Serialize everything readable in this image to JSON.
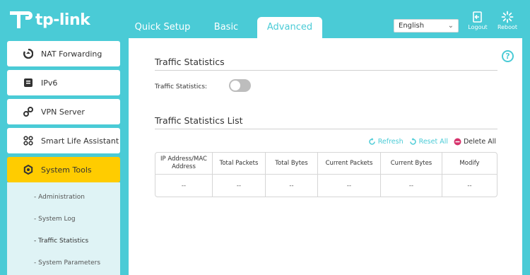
{
  "brand": {
    "name": "tp-link"
  },
  "nav": {
    "tabs": [
      {
        "label": "Quick Setup"
      },
      {
        "label": "Basic"
      },
      {
        "label": "Advanced"
      }
    ]
  },
  "header": {
    "language": {
      "selected": "English"
    },
    "logout_label": "Logout",
    "reboot_label": "Reboot"
  },
  "sidebar": {
    "items": [
      {
        "label": "NAT Forwarding",
        "icon": "nat-icon"
      },
      {
        "label": "IPv6",
        "icon": "ipv6-icon"
      },
      {
        "label": "VPN Server",
        "icon": "vpn-icon"
      },
      {
        "label": "Smart Life Assistant",
        "icon": "smart-life-icon"
      },
      {
        "label": "System Tools",
        "icon": "gear-icon"
      }
    ],
    "submenu": [
      {
        "label": "- Administration"
      },
      {
        "label": "- System Log"
      },
      {
        "label": "- Traffic Statistics"
      },
      {
        "label": "- System Parameters"
      }
    ]
  },
  "main": {
    "section1_title": "Traffic Statistics",
    "toggle_label": "Traffic Statistics:",
    "toggle_on": false,
    "section2_title": "Traffic Statistics List",
    "actions": {
      "refresh": "Refresh",
      "reset_all": "Reset All",
      "delete_all": "Delete All"
    },
    "table": {
      "headers": [
        "IP Address/MAC Address",
        "Total Packets",
        "Total Bytes",
        "Current Packets",
        "Current Bytes",
        "Modify"
      ],
      "rows": [
        [
          "--",
          "--",
          "--",
          "--",
          "--",
          "--"
        ]
      ]
    }
  },
  "colors": {
    "accent": "#4acbd6",
    "active": "#ffcc00",
    "delete": "#d6336c"
  }
}
